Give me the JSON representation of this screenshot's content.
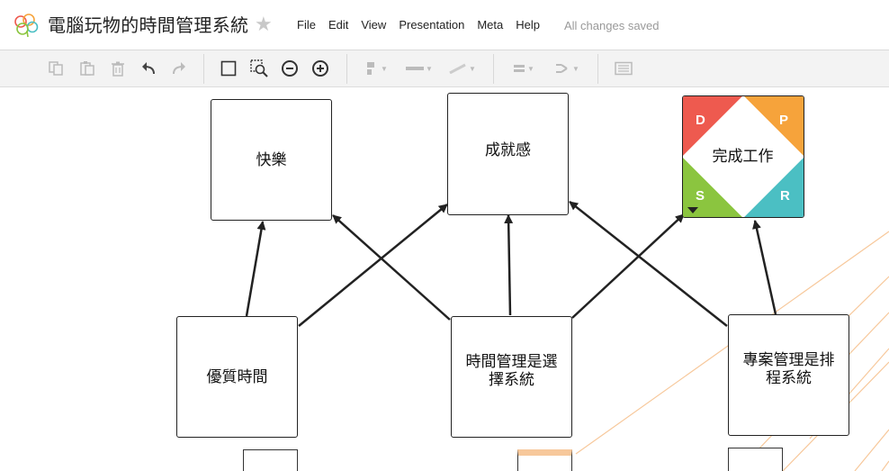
{
  "header": {
    "title": "電腦玩物的時間管理系統",
    "menu": [
      "File",
      "Edit",
      "View",
      "Presentation",
      "Meta",
      "Help"
    ],
    "status": "All changes saved"
  },
  "toolbar": {
    "icons": [
      "copy-icon",
      "paste-icon",
      "delete-icon",
      "undo-icon",
      "redo-icon",
      "select-box-icon",
      "zoom-fit-icon",
      "zoom-out-icon",
      "zoom-in-icon",
      "node-style-icon",
      "line-style-icon",
      "line-color-icon",
      "align-icon",
      "layout-icon",
      "outline-view-icon"
    ]
  },
  "canvas": {
    "nodes": {
      "happiness": "快樂",
      "achievement": "成就感",
      "complete_work": "完成工作",
      "quality_time": "優質時間",
      "time_mgmt_choice": "時間管理是選擇系統",
      "project_mgmt": "專案管理是排程系統"
    },
    "dpsr": {
      "d": "D",
      "p": "P",
      "s": "S",
      "r": "R"
    },
    "colors": {
      "d": "#ee5a4f",
      "p": "#f6a33b",
      "s": "#8bc53f",
      "r": "#4bbfc3",
      "link": "#f7c89b"
    }
  }
}
